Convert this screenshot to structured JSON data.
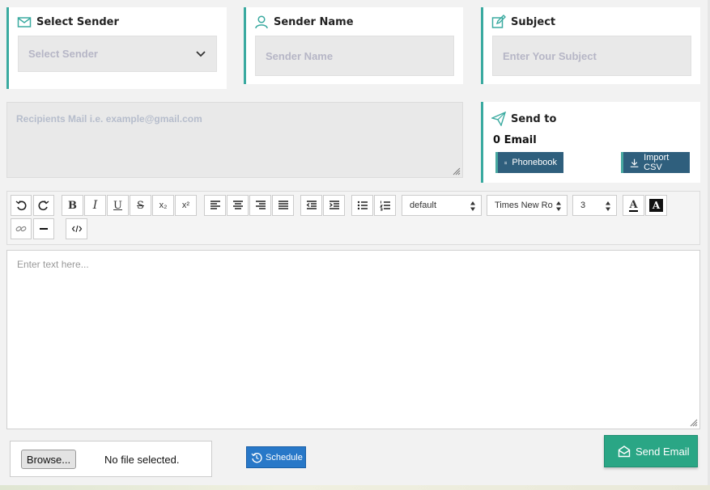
{
  "sender_card": {
    "title": "Select Sender",
    "select_value": "Select Sender"
  },
  "name_card": {
    "title": "Sender Name",
    "placeholder": "Sender Name"
  },
  "subject_card": {
    "title": "Subject",
    "placeholder": "Enter Your Subject"
  },
  "recipients": {
    "placeholder": "Recipients Mail i.e. example@gmail.com"
  },
  "send_to": {
    "title": "Send to",
    "count": "0 Email",
    "phonebook_label": "Phonebook",
    "import_label": "Import CSV"
  },
  "toolbar": {
    "bold": "B",
    "italic": "I",
    "underline": "U",
    "strike": "S",
    "subscript": "x₂",
    "superscript": "x²",
    "format_select": "default",
    "font_select": "Times New Ro",
    "size_select": "3",
    "font_color": "A",
    "bg_color": "A"
  },
  "editor": {
    "placeholder": "Enter text here..."
  },
  "file": {
    "browse_label": "Browse...",
    "status": "No file selected."
  },
  "schedule_label": "Schedule",
  "send_label": "Send Email",
  "colors": {
    "accent": "#3aaaa0",
    "button_dark": "#2f5f7d",
    "schedule": "#2878c8",
    "send": "#2aa685"
  }
}
